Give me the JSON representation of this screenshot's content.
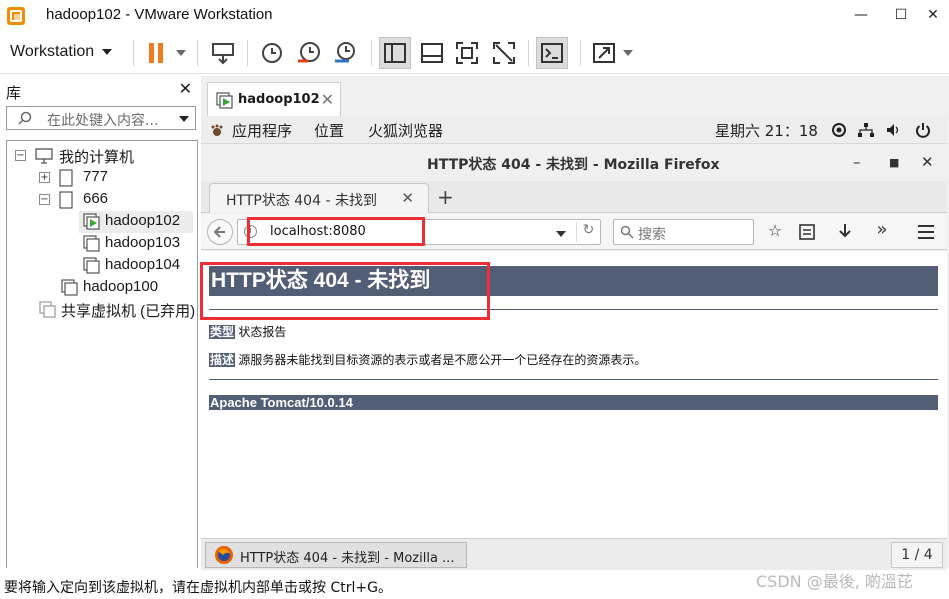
{
  "window": {
    "title": "hadoop102 - VMware Workstation",
    "minimize": "—",
    "maximize": "☐",
    "close": "✕"
  },
  "toolbar": {
    "menu_label": "Workstation",
    "icons": [
      "pause-icon",
      "send-keys-icon",
      "snapshot-take-icon",
      "snapshot-revert-icon",
      "snapshot-manager-icon",
      "library-view-icon",
      "thumbnail-view-icon",
      "fullscreen-icon",
      "unity-icon",
      "console-icon",
      "stretch-icon"
    ]
  },
  "library": {
    "title": "库",
    "close": "✕",
    "search_placeholder": "在此处键入内容...",
    "tree": {
      "root": "我的计算机",
      "items": [
        {
          "label": "777"
        },
        {
          "label": "666"
        },
        {
          "label": "hadoop102",
          "running": true,
          "selected": true
        },
        {
          "label": "hadoop103"
        },
        {
          "label": "hadoop104"
        },
        {
          "label": "hadoop100"
        }
      ],
      "shared": "共享虚拟机 (已弃用)"
    }
  },
  "vm_tab": {
    "label": "hadoop102",
    "close": "✕"
  },
  "guest_topbar": {
    "applications": "应用程序",
    "places": "位置",
    "browser": "火狐浏览器",
    "clock": "星期六 21：18"
  },
  "firefox": {
    "window_title": "HTTP状态 404 - 未找到 - Mozilla Firefox",
    "tab_title": "HTTP状态 404 - 未找到",
    "tab_close": "✕",
    "new_tab": "+",
    "url": "localhost:8080",
    "search_placeholder": "搜索"
  },
  "page": {
    "heading": "HTTP状态 404 - 未找到",
    "type_label": "类型",
    "type_value": "状态报告",
    "desc_label": "描述",
    "desc_value": "源服务器未能找到目标资源的表示或者是不愿公开一个已经存在的资源表示。",
    "footer": "Apache Tomcat/10.0.14"
  },
  "guest_taskbar": {
    "window_label": "HTTP状态 404 - 未找到 - Mozilla ...",
    "pager": "1 / 4"
  },
  "status": {
    "message": "要将输入定向到该虚拟机，请在虚拟机内部单击或按 Ctrl+G。"
  },
  "watermark": "CSDN @最後, 啲溫芘",
  "colors": {
    "tomcat_header": "#525d76",
    "highlight_box": "#ee2e35",
    "pause_orange": "#f07c1e"
  }
}
